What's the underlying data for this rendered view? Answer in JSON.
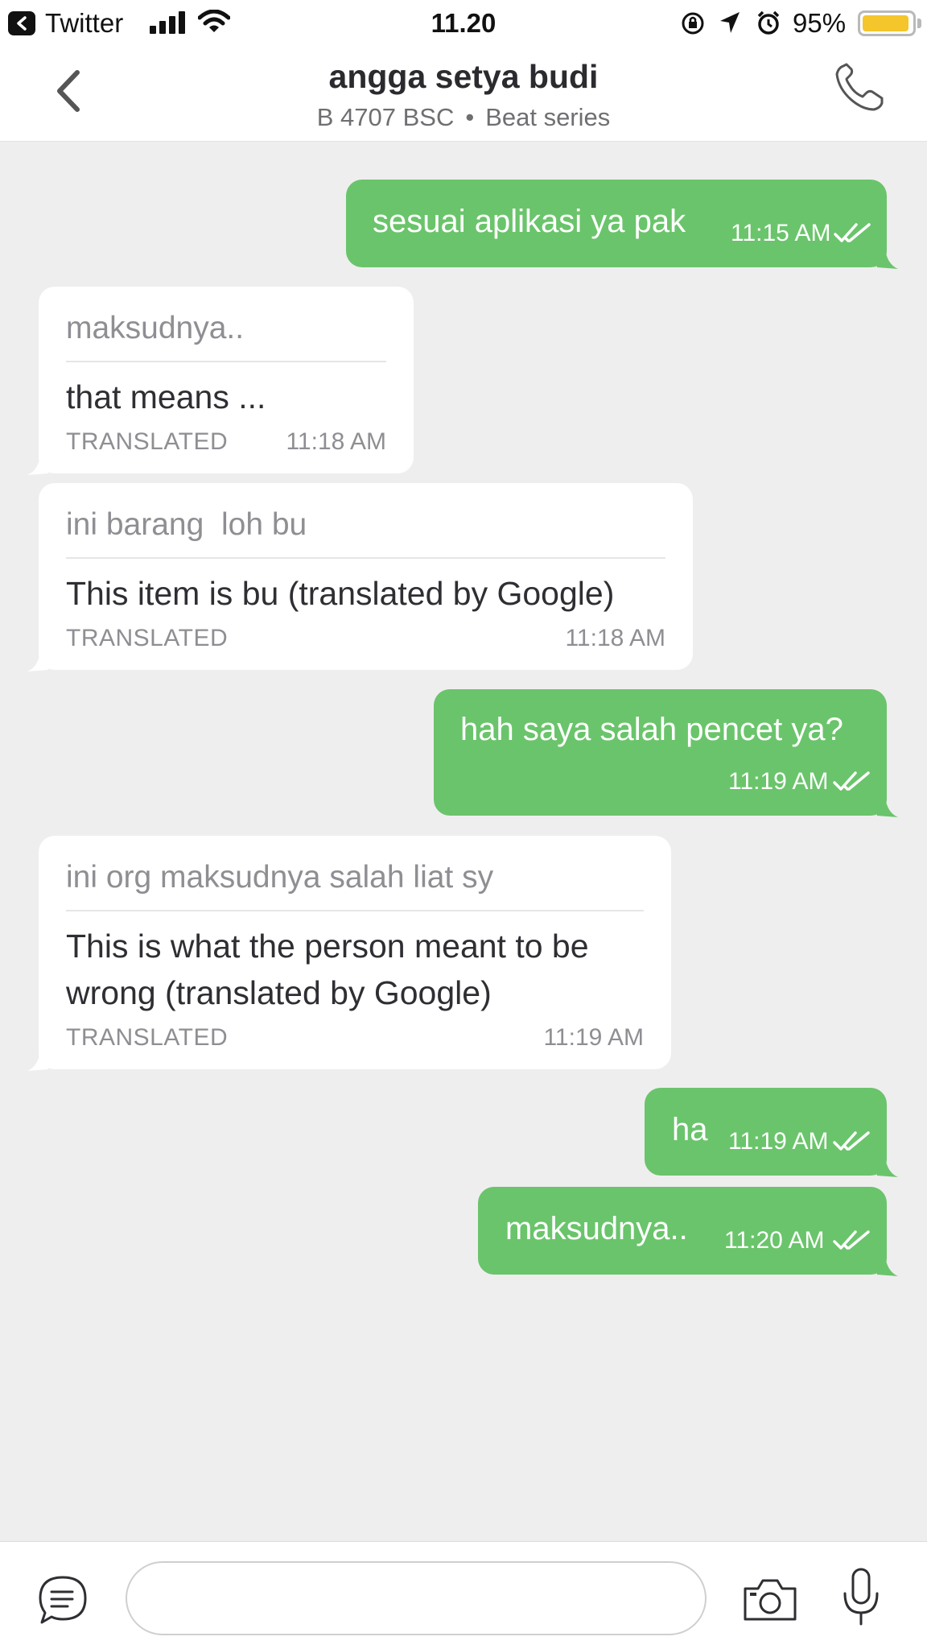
{
  "status_bar": {
    "back_app": "Twitter",
    "time": "11.20",
    "battery": "95%",
    "battery_level": 0.95
  },
  "header": {
    "contact_name": "angga setya budi",
    "plate": "B 4707 BSC",
    "vehicle": "Beat series",
    "back_icon": "chevron-left-icon",
    "call_icon": "phone-icon"
  },
  "messages": [
    {
      "direction": "out",
      "text": "sesuai aplikasi ya pak",
      "time": "11:15 AM",
      "status": "read"
    },
    {
      "direction": "in",
      "original": "maksudnya..",
      "translation": "that means ...",
      "label": "TRANSLATED",
      "time": "11:18 AM"
    },
    {
      "direction": "in",
      "original": "ini barang  loh bu",
      "translation": "This item is bu (translated by Google)",
      "label": "TRANSLATED",
      "time": "11:18 AM"
    },
    {
      "direction": "out",
      "text": "hah saya salah pencet ya?",
      "time": "11:19 AM",
      "status": "read"
    },
    {
      "direction": "in",
      "original": "ini org maksudnya salah liat sy",
      "translation": "This is what the person meant to be wrong (translated by Google)",
      "label": "TRANSLATED",
      "time": "11:19 AM"
    },
    {
      "direction": "out",
      "text": "ha",
      "time": "11:19 AM",
      "status": "read"
    },
    {
      "direction": "out",
      "text": "maksudnya..",
      "time": "11:20 AM",
      "status": "read"
    }
  ],
  "composer": {
    "placeholder": "",
    "chat_icon": "chat-bubble-icon",
    "camera_icon": "camera-icon",
    "mic_icon": "microphone-icon"
  },
  "colors": {
    "outgoing_bubble": "#6ac46b",
    "incoming_bubble": "#ffffff",
    "background": "#efeeef",
    "battery": "#f5c52c"
  }
}
